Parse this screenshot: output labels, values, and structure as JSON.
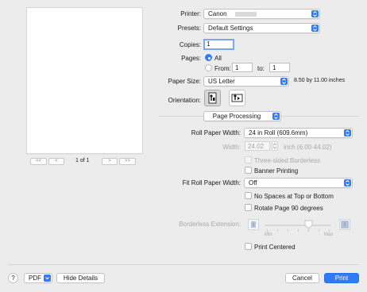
{
  "preview": {
    "first": "<<",
    "prev": "<",
    "page_label": "1 of 1",
    "next": ">",
    "last": ">>"
  },
  "printer": {
    "label": "Printer:",
    "value": "Canon"
  },
  "presets": {
    "label": "Presets:",
    "value": "Default Settings"
  },
  "copies": {
    "label": "Copies:",
    "value": "1"
  },
  "pages": {
    "label": "Pages:",
    "all_label": "All",
    "from_label": "From:",
    "from_value": "1",
    "to_label": "to:",
    "to_value": "1"
  },
  "paper_size": {
    "label": "Paper Size:",
    "value": "US Letter",
    "dimensions": "8.50 by 11.00 inches"
  },
  "orientation": {
    "label": "Orientation:"
  },
  "section": {
    "value": "Page Processing"
  },
  "roll_paper_width": {
    "label": "Roll Paper Width:",
    "value": "24 in Roll (609.6mm)"
  },
  "width": {
    "label": "Width:",
    "value": "24.02",
    "unit": "inch (6.00-44.02)"
  },
  "three_sided": {
    "label": "Three-sided Borderless"
  },
  "banner": {
    "label": "Banner Printing"
  },
  "fit_roll": {
    "label": "Fit Roll Paper Width:",
    "value": "Off"
  },
  "no_spaces": {
    "label": "No Spaces at Top or Bottom"
  },
  "rotate": {
    "label": "Rotate Page 90 degrees"
  },
  "borderless_ext": {
    "label": "Borderless Extension:",
    "min_label": "Min",
    "max_label": "Max"
  },
  "print_centered": {
    "label": "Print Centered"
  },
  "footer": {
    "help": "?",
    "pdf": "PDF",
    "hide_details": "Hide Details",
    "cancel": "Cancel",
    "print": "Print"
  },
  "colors": {
    "accent": "#2f7bf5",
    "background": "#ececec"
  }
}
